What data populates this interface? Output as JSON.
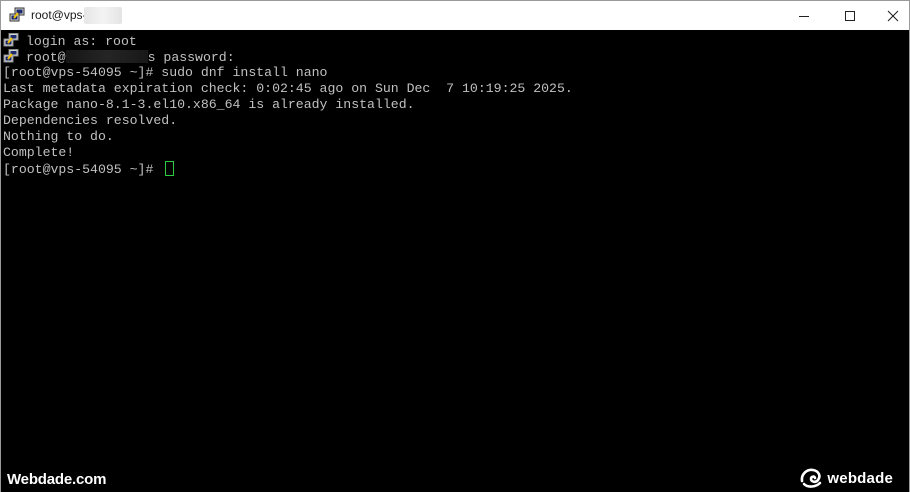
{
  "window": {
    "title": "root@vps-",
    "minimize_icon": "minimize-icon",
    "maximize_icon": "maximize-icon",
    "close_icon": "close-icon"
  },
  "terminal": {
    "lines": [
      {
        "text": "login as: root",
        "icon": "putty-icon"
      },
      {
        "prefix": "root@",
        "suffix": "s password:",
        "icon": "putty-icon"
      },
      {
        "text": "[root@vps-54095 ~]# sudo dnf install nano"
      },
      {
        "text": "Last metadata expiration check: 0:02:45 ago on Sun Dec  7 10:19:25 2025."
      },
      {
        "text": "Package nano-8.1-3.el10.x86_64 is already installed."
      },
      {
        "text": "Dependencies resolved."
      },
      {
        "text": "Nothing to do."
      },
      {
        "text": "Complete!"
      },
      {
        "text": "[root@vps-54095 ~]# "
      }
    ],
    "text_color": "#c0c0c0",
    "background": "#000000",
    "cursor_color": "#2ecc40"
  },
  "watermark": {
    "left": "Webdade.com",
    "right": "webdade"
  }
}
